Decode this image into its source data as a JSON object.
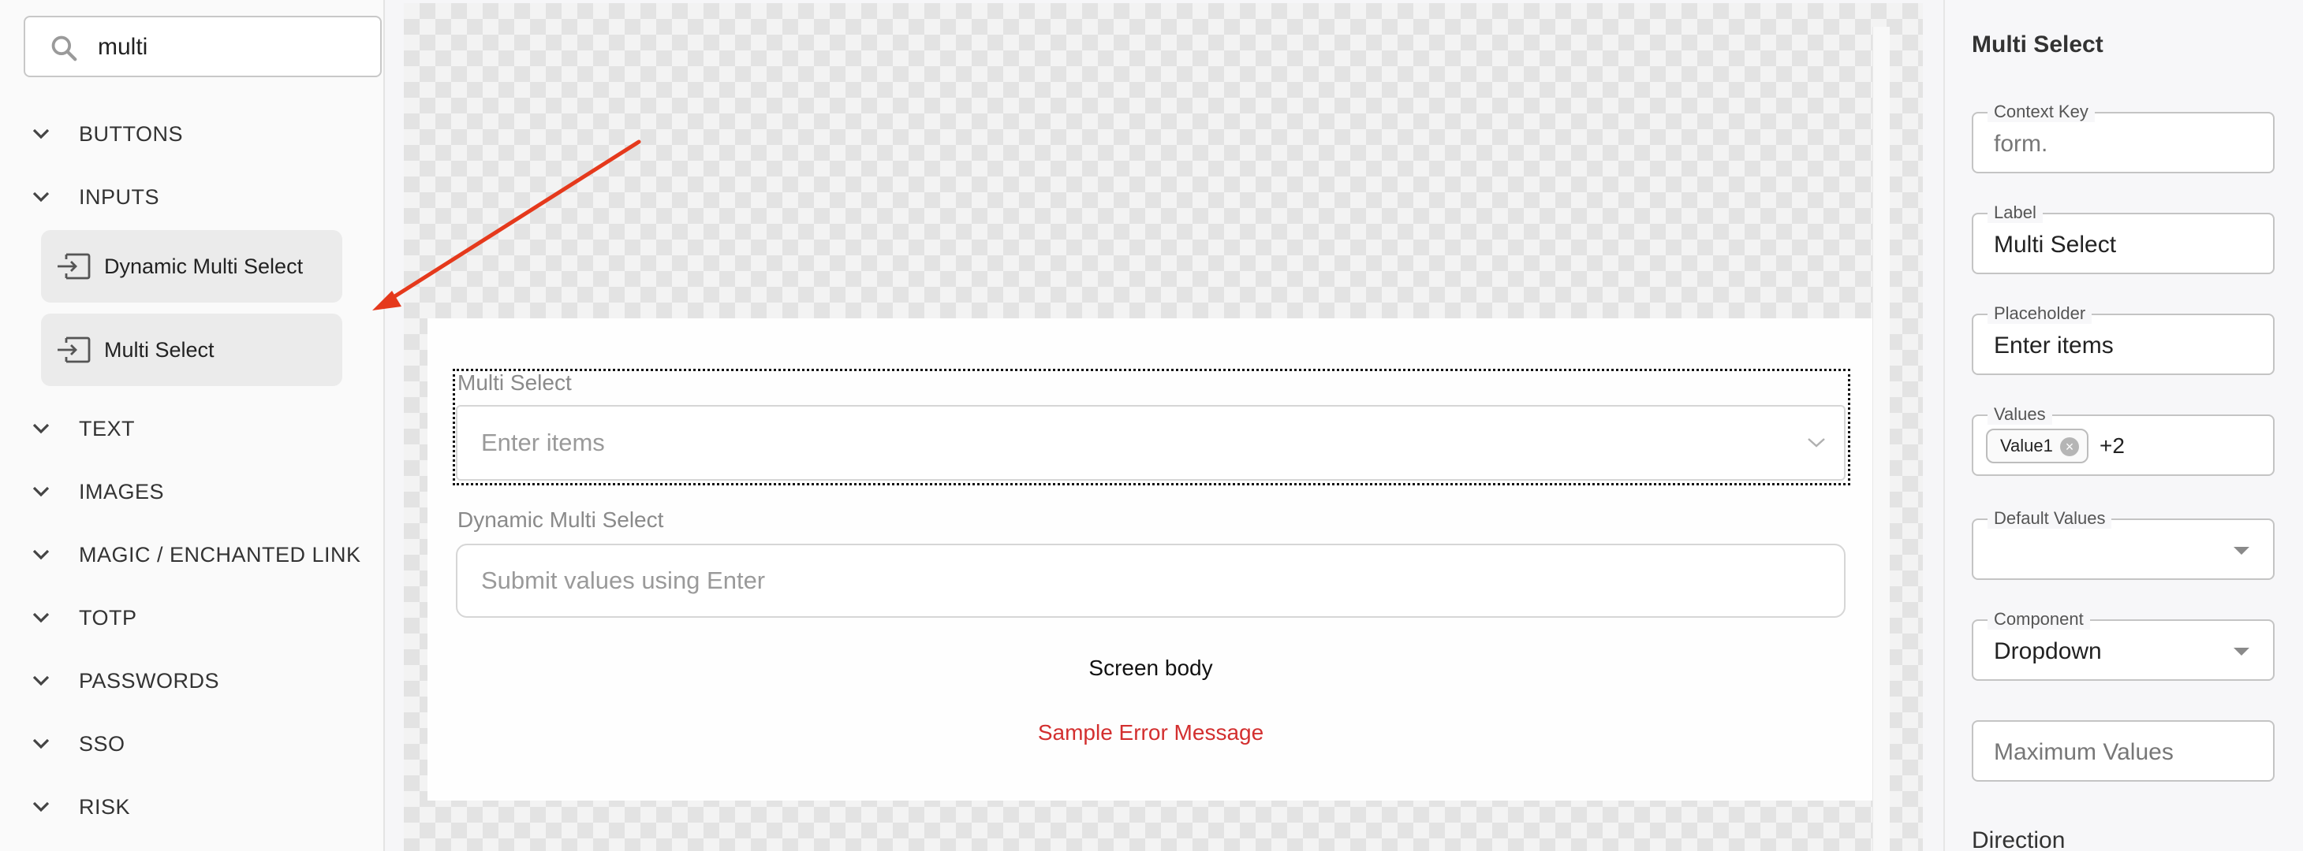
{
  "search": {
    "value": "multi",
    "icon": "search-icon"
  },
  "palette": {
    "sections": [
      {
        "label": "BUTTONS"
      },
      {
        "label": "INPUTS"
      },
      {
        "label": "TEXT"
      },
      {
        "label": "IMAGES"
      },
      {
        "label": "MAGIC / ENCHANTED LINK"
      },
      {
        "label": "TOTP"
      },
      {
        "label": "PASSWORDS"
      },
      {
        "label": "SSO"
      },
      {
        "label": "RISK"
      }
    ],
    "inputs_items": [
      {
        "label": "Dynamic Multi Select",
        "icon": "input-icon"
      },
      {
        "label": "Multi Select",
        "icon": "input-icon"
      }
    ]
  },
  "screen": {
    "multi_select": {
      "label": "Multi Select",
      "placeholder": "Enter items"
    },
    "dynamic_multi_select": {
      "label": "Dynamic Multi Select",
      "placeholder": "Submit values using Enter"
    },
    "body_text": "Screen body",
    "error_text": "Sample Error Message"
  },
  "properties": {
    "title": "Multi Select",
    "context_key": {
      "label": "Context Key",
      "value": "form."
    },
    "label": {
      "label": "Label",
      "value": "Multi Select"
    },
    "placeholder": {
      "label": "Placeholder",
      "value": "Enter items"
    },
    "values": {
      "label": "Values",
      "chip": "Value1",
      "more": "+2"
    },
    "default_values": {
      "label": "Default Values",
      "value": ""
    },
    "component": {
      "label": "Component",
      "value": "Dropdown"
    },
    "maximum_values": {
      "placeholder": "Maximum Values"
    },
    "direction_label": "Direction"
  },
  "colors": {
    "error": "#d32f2f",
    "arrow": "#e5391c",
    "selected_outline": "#111111"
  }
}
